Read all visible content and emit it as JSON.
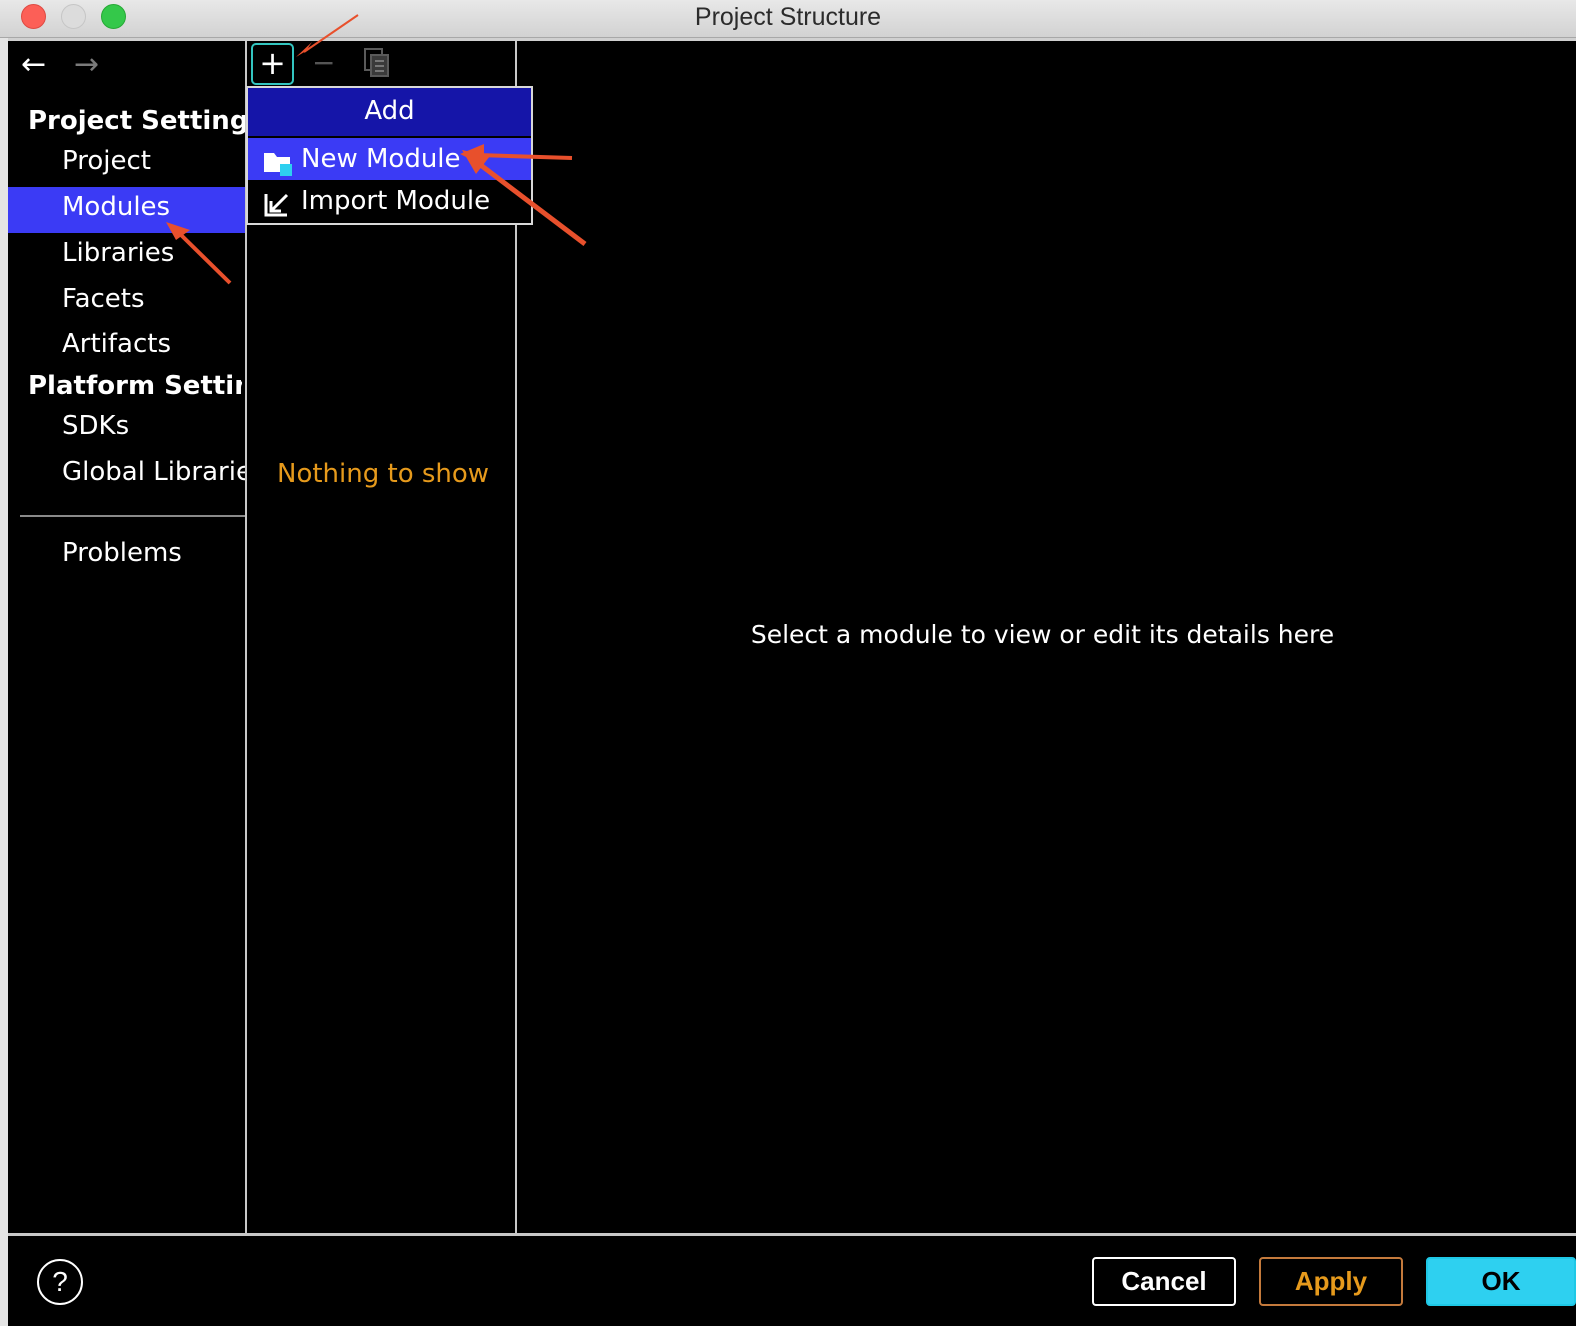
{
  "window": {
    "title": "Project Structure"
  },
  "sidebar": {
    "sections": [
      {
        "title": "Project Settings",
        "items": [
          "Project",
          "Modules",
          "Libraries",
          "Facets",
          "Artifacts"
        ]
      },
      {
        "title": "Platform Setting",
        "items": [
          "SDKs",
          "Global Librarie"
        ]
      }
    ],
    "selected": "Modules",
    "problems": "Problems"
  },
  "toolbar": {
    "add_label": "+",
    "remove_label": "−"
  },
  "add_menu": {
    "header": "Add",
    "items": [
      {
        "label": "New Module",
        "icon": "folder-module-icon",
        "highlighted": true
      },
      {
        "label": "Import Module",
        "icon": "import-arrow-icon",
        "highlighted": false
      }
    ]
  },
  "module_list": {
    "empty_text": "Nothing to show"
  },
  "details": {
    "placeholder": "Select a module to view or edit its details here"
  },
  "buttons": {
    "help": "?",
    "cancel": "Cancel",
    "apply": "Apply",
    "ok": "OK"
  },
  "colors": {
    "selection": "#3b3bf5",
    "menu_header": "#1515a8",
    "empty_text": "#e69a1c",
    "ok_button": "#2ed0f0",
    "annotation_arrow": "#e8502c"
  }
}
